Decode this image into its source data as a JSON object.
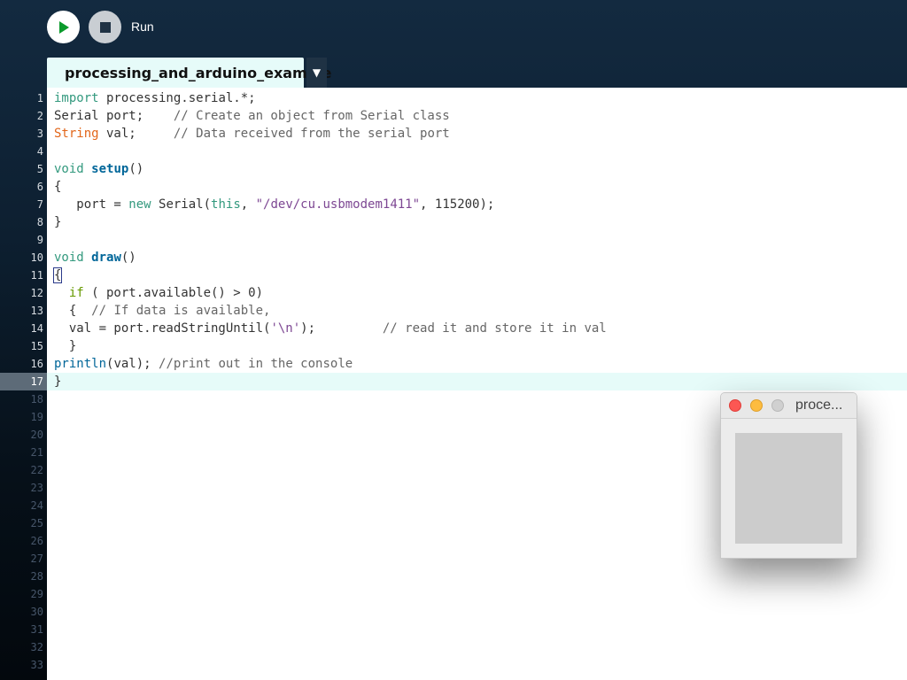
{
  "toolbar": {
    "run_label": "Run",
    "run_icon": "play-icon",
    "stop_icon": "stop-icon"
  },
  "tabs": [
    {
      "label": "processing_and_arduino_example"
    }
  ],
  "tab_menu_glyph": "▼",
  "editor": {
    "line_numbers": [
      "1",
      "2",
      "3",
      "4",
      "5",
      "6",
      "7",
      "8",
      "9",
      "10",
      "11",
      "12",
      "13",
      "14",
      "15",
      "16",
      "17",
      "18",
      "19",
      "20",
      "21",
      "22",
      "23",
      "24",
      "25",
      "26",
      "27",
      "28",
      "29",
      "30",
      "31",
      "32",
      "33"
    ],
    "active_line": 17,
    "lines": [
      "import processing.serial.*;",
      "Serial port;    // Create an object from Serial class",
      "String val;     // Data received from the serial port",
      "",
      "void setup()",
      "{",
      "   port = new Serial(this, \"/dev/cu.usbmodem1411\", 115200);",
      "}",
      "",
      "void draw()",
      "{",
      "  if ( port.available() > 0)",
      "  {  // If data is available,",
      "  val = port.readStringUntil('\\n');         // read it and store it in val",
      "  }",
      "println(val); //print out in the console",
      "}"
    ],
    "tokens": {
      "l1": [
        "import",
        " processing.serial.*;"
      ],
      "l2": [
        "Serial port;    ",
        "// Create an object from Serial class"
      ],
      "l3": [
        "String",
        " val;     ",
        "// Data received from the serial port"
      ],
      "l5": [
        "void",
        " ",
        "setup",
        "()"
      ],
      "l7": [
        "   port = ",
        "new",
        " Serial(",
        "this",
        ", ",
        "\"/dev/cu.usbmodem1411\"",
        ", 115200);"
      ],
      "l10": [
        "void",
        " ",
        "draw",
        "()"
      ],
      "l12": [
        "  ",
        "if",
        " ( port.available() > 0)"
      ],
      "l13": [
        "  {  ",
        "// If data is available,"
      ],
      "l14": [
        "  val = port.readStringUntil(",
        "'\\n'",
        ");         ",
        "// read it and store it in val"
      ],
      "l16": [
        "println",
        "(val); ",
        "//print out in the console"
      ]
    }
  },
  "sketch_window": {
    "title": "proce..."
  },
  "colors": {
    "keyword": "#33997e",
    "function": "#006699",
    "type": "#e2661a",
    "comment": "#666666",
    "string": "#7d4793",
    "control": "#669900",
    "active_line_bg": "#e6fbf9"
  }
}
